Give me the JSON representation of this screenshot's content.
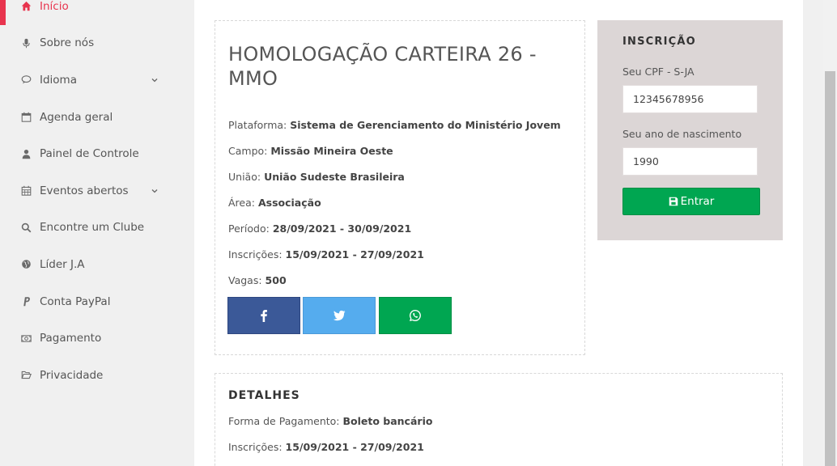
{
  "sidebar": {
    "items": [
      {
        "label": "Início",
        "icon": "home-icon"
      },
      {
        "label": "Sobre nós",
        "icon": "microphone-icon"
      },
      {
        "label": "Idioma",
        "icon": "chat-icon"
      },
      {
        "label": "Agenda geral",
        "icon": "calendar-icon"
      },
      {
        "label": "Painel de Controle",
        "icon": "user-icon"
      },
      {
        "label": "Eventos abertos",
        "icon": "calendar-grid-icon"
      },
      {
        "label": "Encontre um Clube",
        "icon": "search-icon"
      },
      {
        "label": "Líder J.A",
        "icon": "globe-icon"
      },
      {
        "label": "Conta PayPal",
        "icon": "paypal-icon"
      },
      {
        "label": "Pagamento",
        "icon": "money-icon"
      },
      {
        "label": "Privacidade",
        "icon": "folder-open-icon"
      }
    ],
    "accent_color": "#e8344e"
  },
  "event": {
    "title": "HOMOLOGAÇÃO CARTEIRA 26 - MMO",
    "rows": [
      {
        "label": "Plataforma:",
        "value": "Sistema de Gerenciamento do Ministério Jovem"
      },
      {
        "label": "Campo:",
        "value": "Missão Mineira Oeste"
      },
      {
        "label": "União:",
        "value": "União Sudeste Brasileira"
      },
      {
        "label": "Área:",
        "value": "Associação"
      },
      {
        "label": "Período:",
        "value": "28/09/2021 - 30/09/2021"
      },
      {
        "label": "Inscrições:",
        "value": "15/09/2021 - 27/09/2021"
      },
      {
        "label": "Vagas:",
        "value": "500"
      }
    ],
    "share": {
      "facebook_icon": "facebook-icon",
      "twitter_icon": "twitter-icon",
      "whatsapp_icon": "whatsapp-icon",
      "colors": {
        "facebook": "#3b5998",
        "twitter": "#55acee",
        "whatsapp": "#00a651"
      }
    }
  },
  "registration": {
    "title": "INSCRIÇÃO",
    "cpf_label": "Seu CPF - S-JA",
    "cpf_value": "12345678956",
    "birth_label": "Seu ano de nascimento",
    "birth_value": "1990",
    "submit_label": "Entrar",
    "submit_icon": "floppy-disk-icon",
    "background": "#dcd6d6",
    "button_color": "#00a651"
  },
  "details": {
    "title": "DETALHES",
    "rows": [
      {
        "label": "Forma de Pagamento:",
        "value": "Boleto bancário"
      },
      {
        "label": "Inscrições:",
        "value": "15/09/2021 - 27/09/2021"
      }
    ]
  }
}
